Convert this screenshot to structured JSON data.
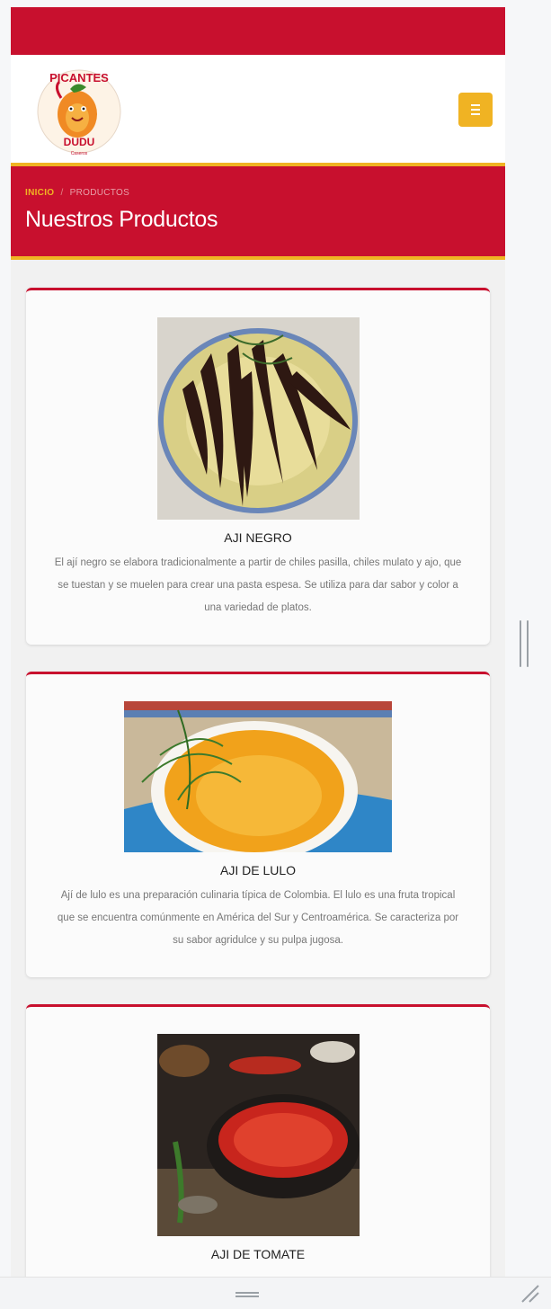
{
  "brand": {
    "logo_line1": "PICANTES",
    "logo_line2": "DUDU",
    "logo_line3": "Caseros",
    "primary_color": "#c8102e",
    "accent_color": "#f0b323"
  },
  "header": {
    "menu_icon": "hamburger-icon"
  },
  "hero": {
    "breadcrumb_home": "INICIO",
    "breadcrumb_separator": "/",
    "breadcrumb_current": "PRODUCTOS",
    "title": "Nuestros Productos"
  },
  "products": [
    {
      "name": "AJI NEGRO",
      "description": "El ají negro se elabora tradicionalmente a partir de chiles pasilla, chiles mulato y ajo, que se tuestan y se muelen para crear una pasta espesa. Se utiliza para dar sabor y color a una variedad de platos."
    },
    {
      "name": "AJI DE LULO",
      "description": "Ají de lulo es una preparación culinaria típica de Colombia. El lulo es una fruta tropical que se encuentra comúnmente en América del Sur y Centroamérica. Se caracteriza por su sabor agridulce y su pulpa jugosa."
    },
    {
      "name": "AJI DE TOMATE",
      "description": ""
    }
  ]
}
